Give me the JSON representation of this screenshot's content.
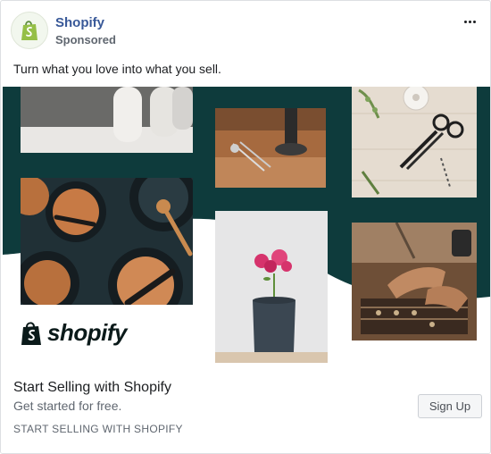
{
  "ad": {
    "page_name": "Shopify",
    "sponsored_label": "Sponsored",
    "more_icon": "more-options-icon",
    "body_text": "Turn what you love into what you sell."
  },
  "creative": {
    "logo_text": "shopify",
    "logo_icon": "shopping-bag-icon",
    "background_color": "#0e3b3c",
    "accent_color": "#95bf47",
    "photos": [
      {
        "name": "photo-white-vases",
        "subject": "white ceramic vases"
      },
      {
        "name": "photo-leather-tools",
        "subject": "leather crafting tools"
      },
      {
        "name": "photo-scissors",
        "subject": "scissors and twine"
      },
      {
        "name": "photo-wooden-bowls",
        "subject": "wooden bowls and plates"
      },
      {
        "name": "photo-flower-vase",
        "subject": "pink flower in vase"
      },
      {
        "name": "photo-jewelry-making",
        "subject": "hands making jewelry"
      }
    ]
  },
  "footer": {
    "headline": "Start Selling with Shopify",
    "description": "Get started for free.",
    "domain_label": "START SELLING WITH SHOPIFY",
    "cta_label": "Sign Up"
  }
}
